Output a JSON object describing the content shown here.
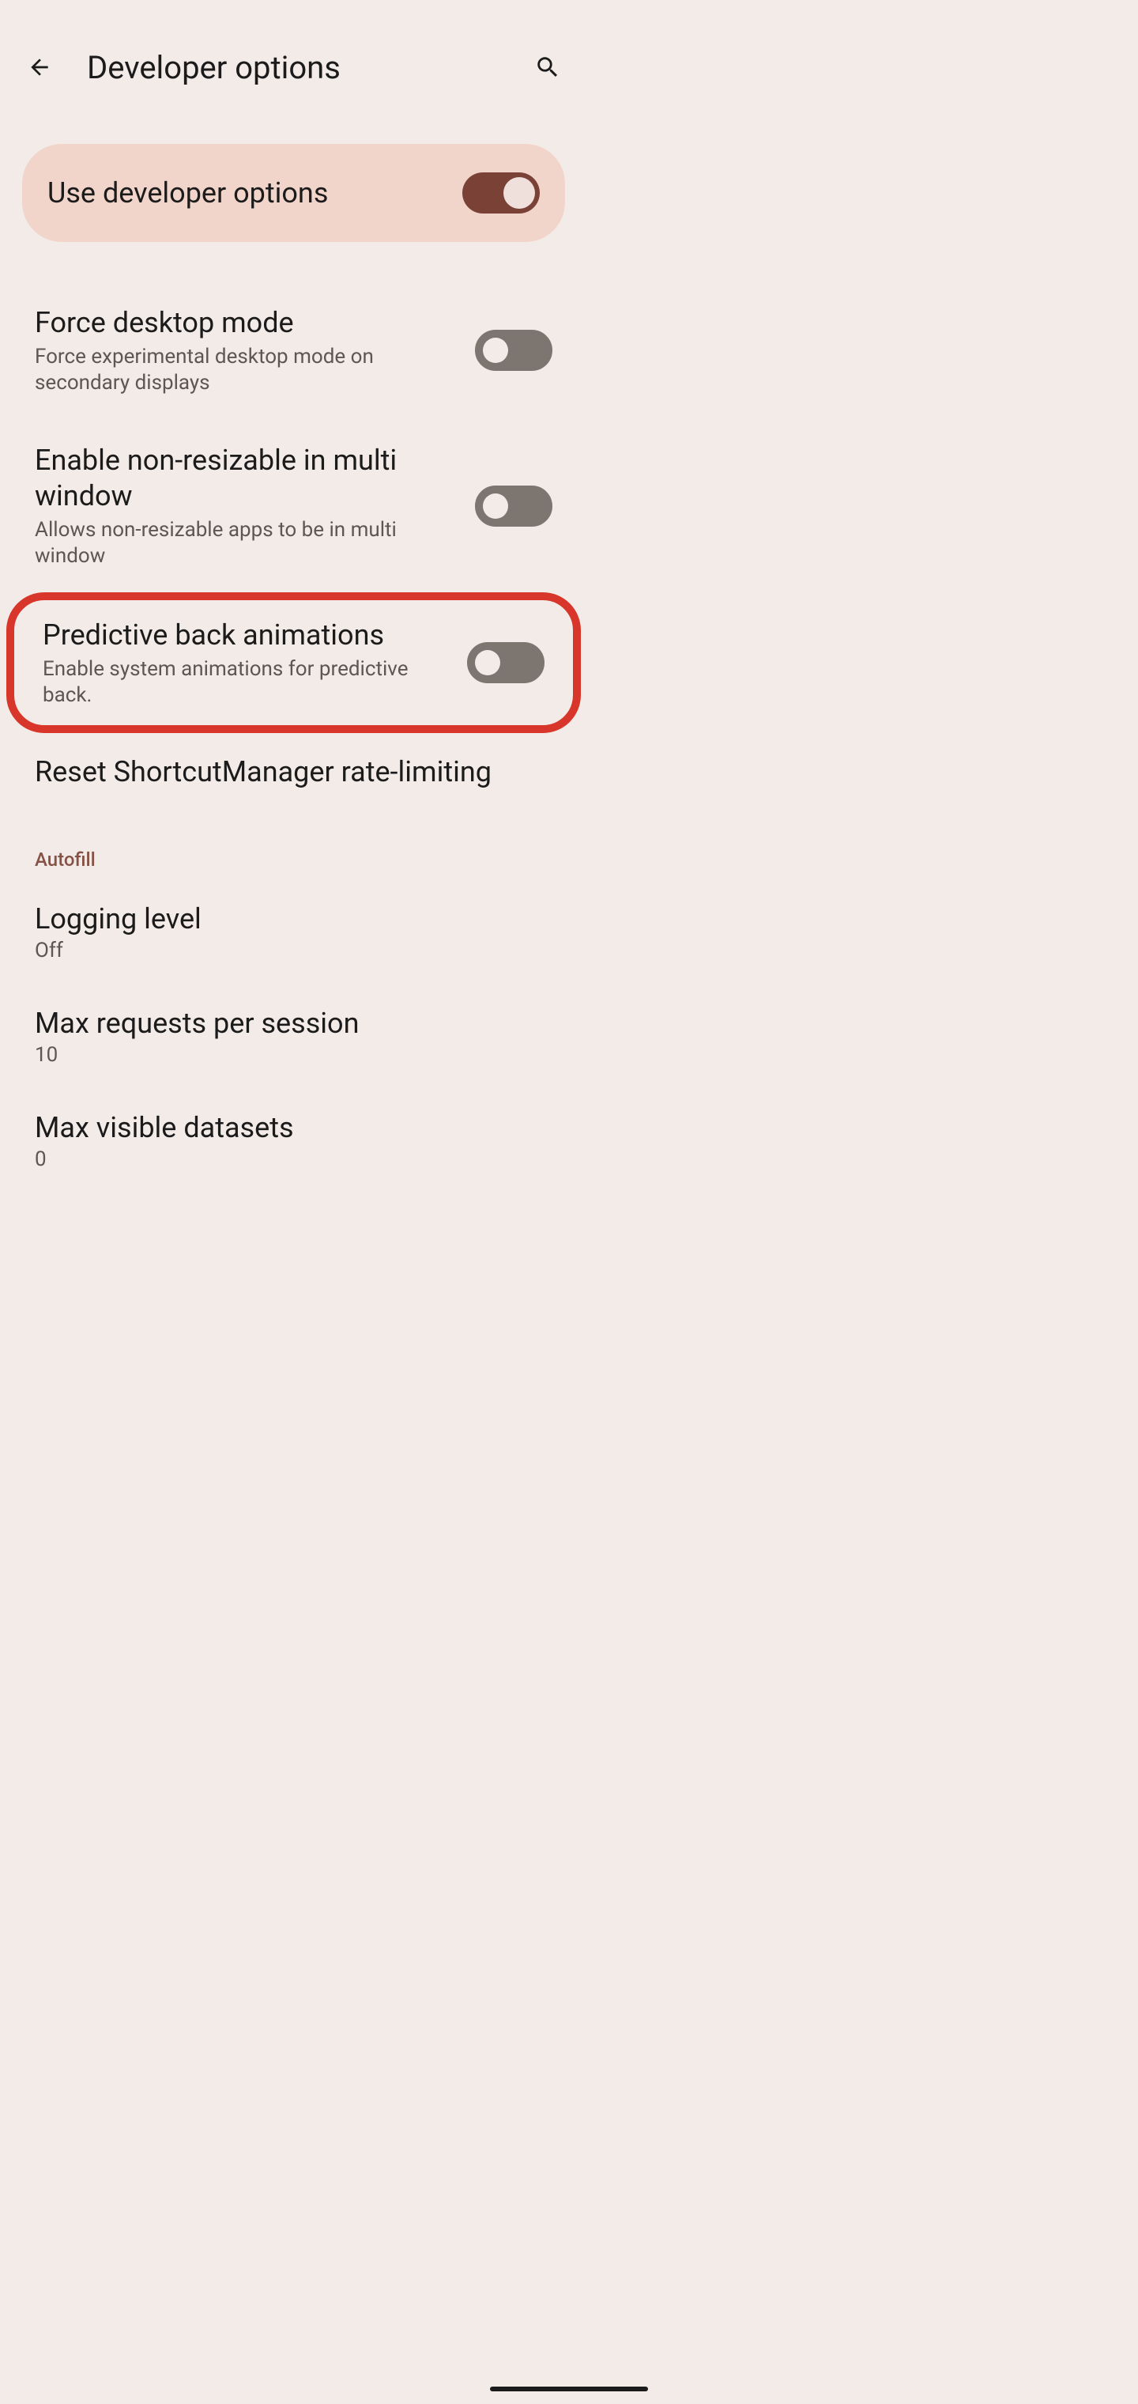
{
  "header": {
    "title": "Developer options"
  },
  "masterToggle": {
    "label": "Use developer options",
    "enabled": true
  },
  "settings": [
    {
      "title": "Force desktop mode",
      "subtitle": "Force experimental desktop mode on secondary displays",
      "enabled": false
    },
    {
      "title": "Enable non-resizable in multi window",
      "subtitle": "Allows non-resizable apps to be in multi window",
      "enabled": false
    },
    {
      "title": "Predictive back animations",
      "subtitle": "Enable system animations for predictive back.",
      "enabled": false,
      "highlighted": true
    }
  ],
  "resetShortcut": {
    "title": "Reset ShortcutManager rate-limiting"
  },
  "sectionHeader": "Autofill",
  "autofillItems": [
    {
      "title": "Logging level",
      "value": "Off"
    },
    {
      "title": "Max requests per session",
      "value": "10"
    },
    {
      "title": "Max visible datasets",
      "value": "0"
    }
  ]
}
